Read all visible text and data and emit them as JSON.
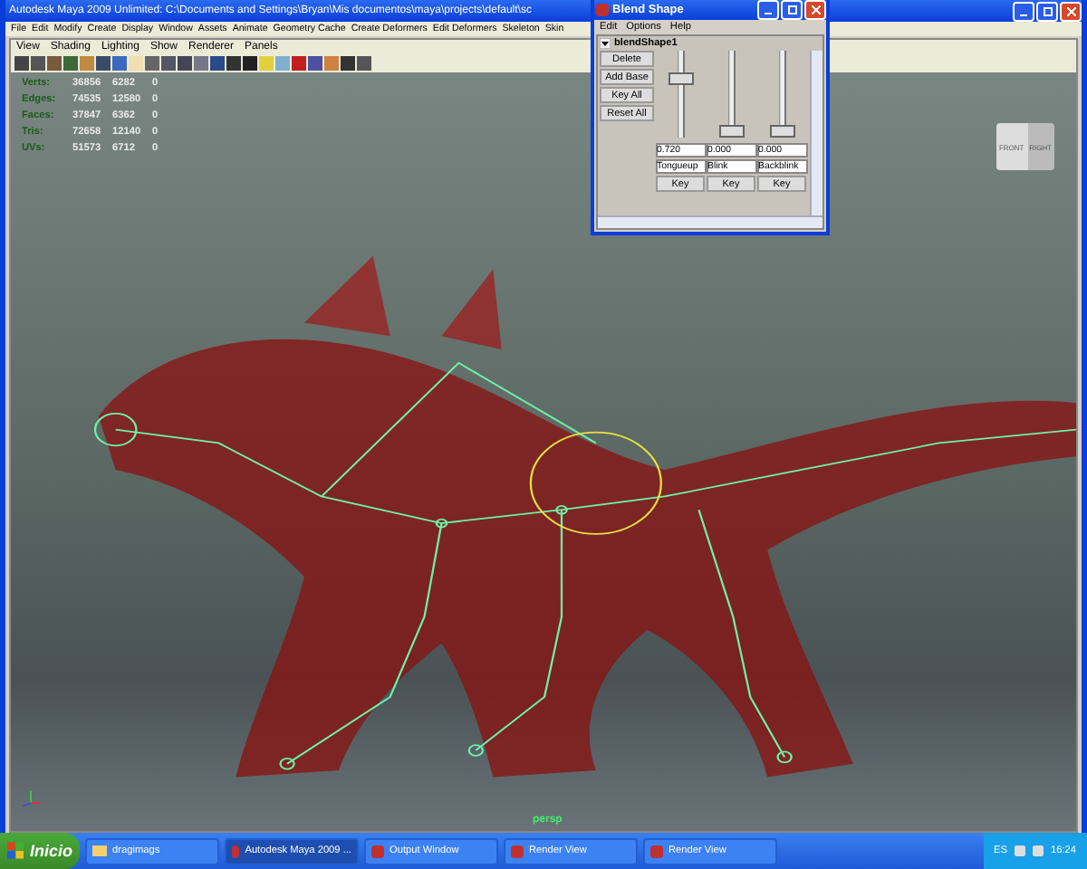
{
  "window": {
    "title": "Autodesk Maya 2009 Unlimited: C:\\Documents and Settings\\Bryan\\Mis documentos\\maya\\projects\\default\\sc"
  },
  "menu_bar": [
    "File",
    "Edit",
    "Modify",
    "Create",
    "Display",
    "Window",
    "Assets",
    "Animate",
    "Geometry Cache",
    "Create Deformers",
    "Edit Deformers",
    "Skeleton",
    "Skin"
  ],
  "panel_menu": [
    "View",
    "Shading",
    "Lighting",
    "Show",
    "Renderer",
    "Panels"
  ],
  "hud": [
    {
      "label": "Verts:",
      "values": [
        "36856",
        "6282",
        "0"
      ]
    },
    {
      "label": "Edges:",
      "values": [
        "74535",
        "12580",
        "0"
      ]
    },
    {
      "label": "Faces:",
      "values": [
        "37847",
        "6362",
        "0"
      ]
    },
    {
      "label": "Tris:",
      "values": [
        "72658",
        "12140",
        "0"
      ]
    },
    {
      "label": "UVs:",
      "values": [
        "51573",
        "6712",
        "0"
      ]
    }
  ],
  "view_cube": {
    "faces": [
      "FRONT",
      "RIGHT"
    ]
  },
  "camera_label": "persp",
  "blend_shape": {
    "title": "Blend Shape",
    "menu": [
      "Edit",
      "Options",
      "Help"
    ],
    "node": "blendShape1",
    "expanded": true,
    "buttons": [
      "Delete",
      "Add Base",
      "Key All",
      "Reset All"
    ],
    "targets": [
      {
        "name": "Tongueup",
        "value": "0.720",
        "level": 0.72,
        "key": "Key"
      },
      {
        "name": "Blink",
        "value": "0.000",
        "level": 0,
        "key": "Key"
      },
      {
        "name": "Backblink",
        "value": "0.000",
        "level": 0,
        "key": "Key"
      }
    ]
  },
  "taskbar": {
    "start": "Inicio",
    "items": [
      {
        "label": "dragimags",
        "kind": "folder",
        "selected": false
      },
      {
        "label": "Autodesk Maya 2009 ...",
        "kind": "app",
        "selected": true
      },
      {
        "label": "Output Window",
        "kind": "app",
        "selected": false
      },
      {
        "label": "Render View",
        "kind": "app",
        "selected": false
      },
      {
        "label": "Render View",
        "kind": "app",
        "selected": false
      }
    ],
    "language": "ES",
    "clock": "16:24"
  }
}
